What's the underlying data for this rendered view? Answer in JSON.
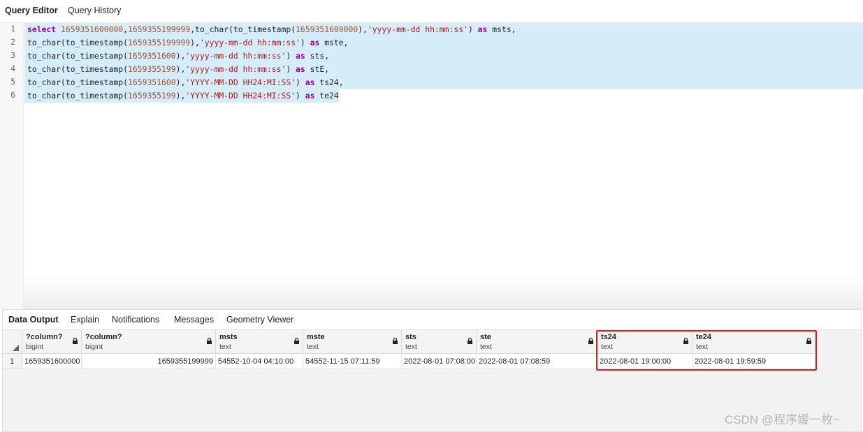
{
  "top_tabs": {
    "query_editor": "Query Editor",
    "query_history": "Query History"
  },
  "editor": {
    "line_numbers": [
      "1",
      "2",
      "3",
      "4",
      "5",
      "6"
    ],
    "lines": [
      [
        [
          "kw",
          "select"
        ],
        [
          "plain",
          " "
        ],
        [
          "num",
          "1659351600000"
        ],
        [
          "plain",
          ","
        ],
        [
          "num",
          "1659355199999"
        ],
        [
          "plain",
          ",to_char(to_timestamp("
        ],
        [
          "num",
          "1659351600000"
        ],
        [
          "plain",
          "),"
        ],
        [
          "str",
          "'yyyy-mm-dd hh:mm:ss'"
        ],
        [
          "plain",
          ") "
        ],
        [
          "kw",
          "as"
        ],
        [
          "plain",
          " msts,"
        ]
      ],
      [
        [
          "plain",
          "to_char(to_timestamp("
        ],
        [
          "num",
          "1659355199999"
        ],
        [
          "plain",
          "),"
        ],
        [
          "str",
          "'yyyy-mm-dd hh:mm:ss'"
        ],
        [
          "plain",
          ") "
        ],
        [
          "kw",
          "as"
        ],
        [
          "plain",
          " mste,"
        ]
      ],
      [
        [
          "plain",
          "to_char(to_timestamp("
        ],
        [
          "num",
          "1659351600"
        ],
        [
          "plain",
          "),"
        ],
        [
          "str",
          "'yyyy-mm-dd hh:mm:ss'"
        ],
        [
          "plain",
          ") "
        ],
        [
          "kw",
          "as"
        ],
        [
          "plain",
          " sts,"
        ]
      ],
      [
        [
          "plain",
          "to_char(to_timestamp("
        ],
        [
          "num",
          "1659355199"
        ],
        [
          "plain",
          "),"
        ],
        [
          "str",
          "'yyyy-mm-dd hh:mm:ss'"
        ],
        [
          "plain",
          ") "
        ],
        [
          "kw",
          "as"
        ],
        [
          "plain",
          " stE,"
        ]
      ],
      [
        [
          "plain",
          "to_char(to_timestamp("
        ],
        [
          "num",
          "1659351600"
        ],
        [
          "plain",
          "),"
        ],
        [
          "str",
          "'YYYY-MM-DD HH24:MI:SS'"
        ],
        [
          "plain",
          ") "
        ],
        [
          "kw",
          "as"
        ],
        [
          "plain",
          " ts24,"
        ]
      ],
      [
        [
          "plain",
          "to_char(to_timestamp("
        ],
        [
          "num",
          "1659355199"
        ],
        [
          "plain",
          "),"
        ],
        [
          "str",
          "'YYYY-MM-DD HH24:MI:SS'"
        ],
        [
          "plain",
          ") "
        ],
        [
          "kw",
          "as"
        ],
        [
          "plain",
          " te24"
        ]
      ]
    ]
  },
  "result_tabs": {
    "data_output": "Data Output",
    "explain": "Explain",
    "notifications": "Notifications",
    "messages": "Messages",
    "geometry_viewer": "Geometry Viewer"
  },
  "grid": {
    "columns": [
      {
        "name": "?column?",
        "type": "bigint"
      },
      {
        "name": "?column?",
        "type": "bigint"
      },
      {
        "name": "msts",
        "type": "text"
      },
      {
        "name": "mste",
        "type": "text"
      },
      {
        "name": "sts",
        "type": "text"
      },
      {
        "name": "ste",
        "type": "text"
      },
      {
        "name": "ts24",
        "type": "text"
      },
      {
        "name": "te24",
        "type": "text"
      }
    ],
    "row_number": "1",
    "row": [
      "1659351600000",
      "1659355199999",
      "54552-10-04 04:10:00",
      "54552-11-15 07:11:59",
      "2022-08-01 07:08:00",
      "2022-08-01 07:08:59",
      "2022-08-01 19:00:00",
      "2022-08-01 19:59:59"
    ]
  },
  "colors": {
    "selection": "#d5ecf9",
    "keyword": "#990099",
    "number": "#a0522d",
    "string": "#b11a1a",
    "highlight_box": "#e01e1e"
  },
  "watermark": "CSDN @程序媛一枚~"
}
